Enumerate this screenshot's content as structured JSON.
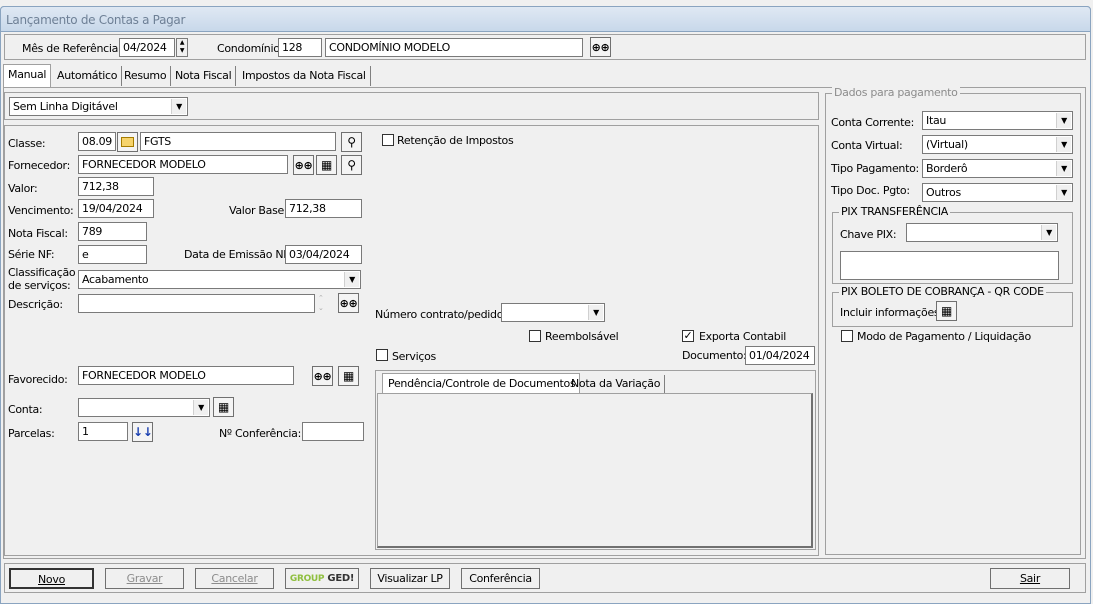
{
  "window": {
    "title": "Lançamento de Contas a Pagar"
  },
  "header": {
    "mes_label": "Mês de Referência:",
    "mes_value": "04/2024",
    "condominio_label": "Condomínio:",
    "condominio_code": "128",
    "condominio_name": "CONDOMÍNIO MODELO"
  },
  "tabs": [
    {
      "label": "Manual"
    },
    {
      "label": "Automático"
    },
    {
      "label": "Resumo"
    },
    {
      "label": "Nota Fiscal"
    },
    {
      "label": "Impostos da Nota Fiscal"
    }
  ],
  "linha_digitavel": {
    "value": "Sem Linha Digitável"
  },
  "form": {
    "classe_label": "Classe:",
    "classe_code": "08.09",
    "classe_name": "FGTS",
    "fornecedor_label": "Fornecedor:",
    "fornecedor_value": "FORNECEDOR MODELO",
    "valor_label": "Valor:",
    "valor_value": "712,38",
    "vencimento_label": "Vencimento:",
    "vencimento_value": "19/04/2024",
    "valor_base_label": "Valor Base:",
    "valor_base_value": "712,38",
    "nota_fiscal_label": "Nota Fiscal:",
    "nota_fiscal_value": "789",
    "serie_label": "Série NF:",
    "serie_value": "e",
    "data_emissao_label": "Data de Emissão NF:",
    "data_emissao_value": "03/04/2024",
    "classificacao_label_1": "Classificação",
    "classificacao_label_2": "de serviços:",
    "classificacao_value": "Acabamento",
    "descricao_label": "Descrição:",
    "descricao_value": "",
    "favorecido_label": "Favorecido:",
    "favorecido_value": "FORNECEDOR MODELO",
    "conta_label": "Conta:",
    "conta_value": "",
    "parcelas_label": "Parcelas:",
    "parcelas_value": "1",
    "conferencia_label": "Nº Conferência:",
    "conferencia_value": ""
  },
  "middle": {
    "retencao_label": "Retenção de Impostos",
    "numero_contrato_label": "Número contrato/pedido:",
    "numero_contrato_value": "",
    "reembolsavel_label": "Reembolsável",
    "exporta_label": "Exporta Contabil",
    "servicos_label": "Serviços",
    "documento_label": "Documento:",
    "documento_value": "01/04/2024",
    "subtabs": [
      {
        "label": "Pendência/Controle de Documentos"
      },
      {
        "label": "Nota da Variação"
      }
    ]
  },
  "pagamento": {
    "group_title": "Dados para pagamento",
    "conta_corrente_label": "Conta Corrente:",
    "conta_corrente_value": "Itau",
    "conta_virtual_label": "Conta Virtual:",
    "conta_virtual_value": "(Virtual)",
    "tipo_pagamento_label": "Tipo Pagamento:",
    "tipo_pagamento_value": "Borderô",
    "tipo_doc_label": "Tipo Doc. Pgto:",
    "tipo_doc_value": "Outros",
    "pix_transf_title": "PIX TRANSFERÊNCIA",
    "chave_pix_label": "Chave PIX:",
    "chave_pix_value": "",
    "pix_boleto_title": "PIX BOLETO DE COBRANÇA - QR CODE",
    "incluir_label": "Incluir informações:",
    "modo_label": "Modo de Pagamento / Liquidação"
  },
  "footer": {
    "novo": "Novo",
    "gravar": "Gravar",
    "cancelar": "Cancelar",
    "ged_1": "GROUP",
    "ged_2": "GED!",
    "visualizar": "Visualizar LP",
    "conferencia": "Conferência",
    "sair": "Sair"
  },
  "colors": {
    "title_bg": "#c8d8ea",
    "ged_green": "#8fbf3f"
  }
}
